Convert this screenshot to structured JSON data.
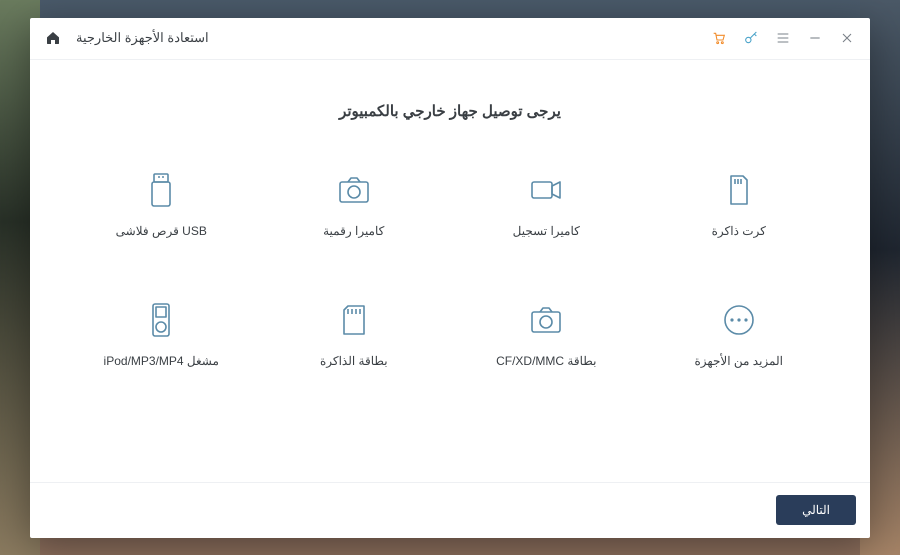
{
  "window": {
    "title": "استعادة الأجهزة الخارجية"
  },
  "heading": "يرجى توصيل جهاز خارجي بالكمبيوتر",
  "devices": [
    {
      "label": "USB قرص فلاشى"
    },
    {
      "label": "كاميرا رقمية"
    },
    {
      "label": "كاميرا تسجيل"
    },
    {
      "label": "كرت ذاكرة"
    },
    {
      "label": "مشغل iPod/MP3/MP4"
    },
    {
      "label": "بطاقة الذاكرة"
    },
    {
      "label": "بطاقة CF/XD/MMC"
    },
    {
      "label": "المزيد من الأجهزة"
    }
  ],
  "footer": {
    "next_label": "التالي"
  },
  "colors": {
    "accent_icon": "#5b8ba8",
    "footer_button": "#2a3d5a",
    "cart_icon": "#f28c2b",
    "key_icon": "#4aa3c9"
  }
}
